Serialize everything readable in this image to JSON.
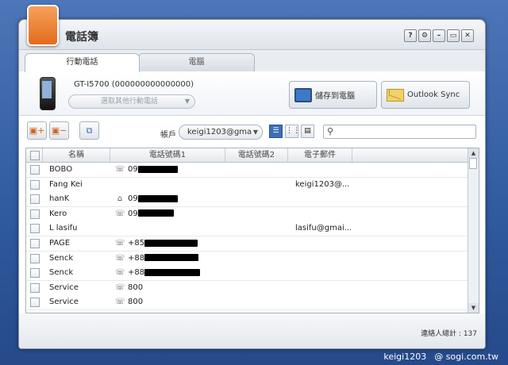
{
  "window": {
    "title": "電話簿"
  },
  "tabs": [
    {
      "label": "行動電話"
    },
    {
      "label": "電腦"
    }
  ],
  "device": {
    "name": "GT-I5700 (000000000000000)",
    "select_placeholder": "選取其他行動電話"
  },
  "actions": {
    "save_to_pc": "儲存到電腦",
    "outlook_sync": "Outlook Sync"
  },
  "toolbar": {
    "account_label": "帳戶",
    "account_value": "keigi1203@gma"
  },
  "table": {
    "headers": [
      "名稱",
      "電話號碼1",
      "電話號碼2",
      "電子郵件"
    ],
    "rows": [
      {
        "name": "BOBO",
        "icon": "mobile-phone-icon",
        "phone1": "09",
        "email": ""
      },
      {
        "name": "Fang Kei",
        "icon": "",
        "phone1": "",
        "email": "keigi1203@..."
      },
      {
        "name": "hanK",
        "icon": "home-icon",
        "phone1": "09",
        "email": ""
      },
      {
        "name": "Kero",
        "icon": "mobile-phone-icon",
        "phone1": "09",
        "email": ""
      },
      {
        "name": "L lasifu",
        "icon": "",
        "phone1": "",
        "email": "lasifu@gmai..."
      },
      {
        "name": "PAGE",
        "icon": "mobile-phone-icon",
        "phone1": "+85",
        "email": ""
      },
      {
        "name": "Senck",
        "icon": "mobile-phone-icon",
        "phone1": "+88",
        "email": ""
      },
      {
        "name": "Senck",
        "icon": "mobile-phone-icon",
        "phone1": "+88",
        "email": ""
      },
      {
        "name": "Service",
        "icon": "mobile-phone-icon",
        "phone1": "800",
        "email": ""
      },
      {
        "name": "Service",
        "icon": "mobile-phone-icon",
        "phone1": "800",
        "email": ""
      }
    ]
  },
  "status": {
    "total_contacts": "連絡人總計 : 137"
  },
  "watermark": {
    "user": "keigi1203",
    "site": "@ sogi.com.tw"
  }
}
